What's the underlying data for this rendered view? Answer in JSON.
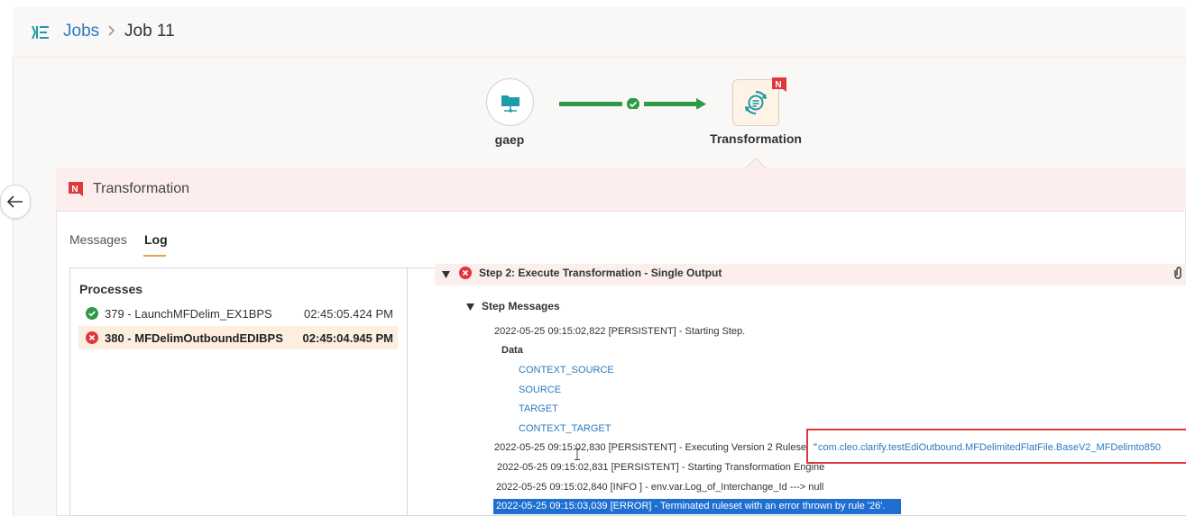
{
  "header": {
    "app_icon": "jobs-app-icon",
    "breadcrumb": [
      "Jobs",
      "Job 11"
    ]
  },
  "pipeline": {
    "nodes": [
      {
        "label": "gaep",
        "icon": "folder-network-icon"
      },
      {
        "label": "Transformation",
        "icon": "transform-cycle-icon",
        "badge": "N"
      }
    ],
    "connector_status": "success"
  },
  "panel": {
    "title": "Transformation",
    "badge": "N",
    "tabs": [
      {
        "label": "Messages",
        "active": false
      },
      {
        "label": "Log",
        "active": true
      }
    ]
  },
  "processes": {
    "title": "Processes",
    "items": [
      {
        "status": "success",
        "name": "379 - LaunchMFDelim_EX1BPS",
        "time": "02:45:05.424 PM",
        "selected": false
      },
      {
        "status": "error",
        "name": "380 - MFDelimOutboundEDIBPS",
        "time": "02:45:04.945 PM",
        "selected": true
      }
    ]
  },
  "log": {
    "step_title": "Step 2: Execute Transformation - Single Output",
    "step_messages_title": "Step Messages",
    "lines": [
      "2022-05-25 09:15:02,822 [PERSISTENT] - Starting Step.",
      "2022-05-25 09:15:02,830 [PERSISTENT] - Executing Version 2 Ruleset:",
      "2022-05-25 09:15:02,831 [PERSISTENT] - Starting Transformation Engine",
      "2022-05-25 09:15:02,840 [INFO ] - env.var.Log_of_Interchange_Id  ---> null"
    ],
    "data_label": "Data",
    "data_items": [
      "CONTEXT_SOURCE",
      "SOURCE",
      "TARGET",
      "CONTEXT_TARGET"
    ],
    "ruleset_quote": "\"",
    "ruleset_link": "com.cleo.clarify.testEdiOutbound.MFDelimitedFlatFile.BaseV2_MFDelimto850",
    "error_line": "2022-05-25 09:15:03,039 [ERROR] - Terminated ruleset with an error thrown by rule '26'."
  },
  "colors": {
    "accent_blue": "#2a7bbf",
    "success_green": "#2e9a47",
    "error_red": "#e0373c",
    "highlight_blue": "#1e6fd1"
  }
}
